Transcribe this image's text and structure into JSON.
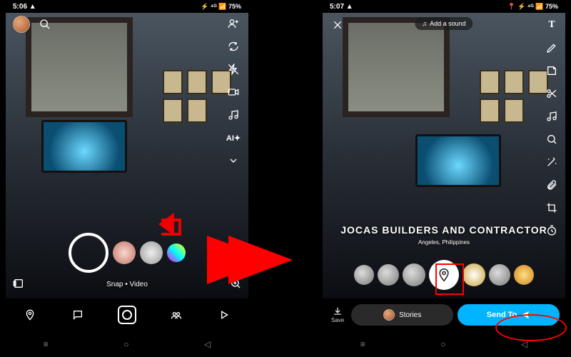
{
  "left": {
    "status": {
      "time": "5:06",
      "indicator": "▲",
      "right": "⚡ ⁴ᴳ 📶 75%"
    },
    "tools": [
      "add-friend",
      "flip",
      "flash",
      "video",
      "music",
      "ai",
      "more"
    ],
    "lens_label": "Snap • Video",
    "nav": [
      "map",
      "chat",
      "camera",
      "stories",
      "play"
    ]
  },
  "right": {
    "status": {
      "time": "5:07",
      "indicator": "▲",
      "right": "📍 ⚡ ⁴ᴳ 📶 75%"
    },
    "sound_label": "Add a sound",
    "tools": [
      "text",
      "draw",
      "sticker",
      "cut",
      "music",
      "sparkle",
      "wand",
      "attach",
      "crop",
      "timer"
    ],
    "location": {
      "title": "JOCAS BUILDERS AND CONTRACTOR",
      "subtitle": "Angeles, Philippines"
    },
    "actions": {
      "save": "Save",
      "stories": "Stories",
      "send": "Send To"
    }
  }
}
